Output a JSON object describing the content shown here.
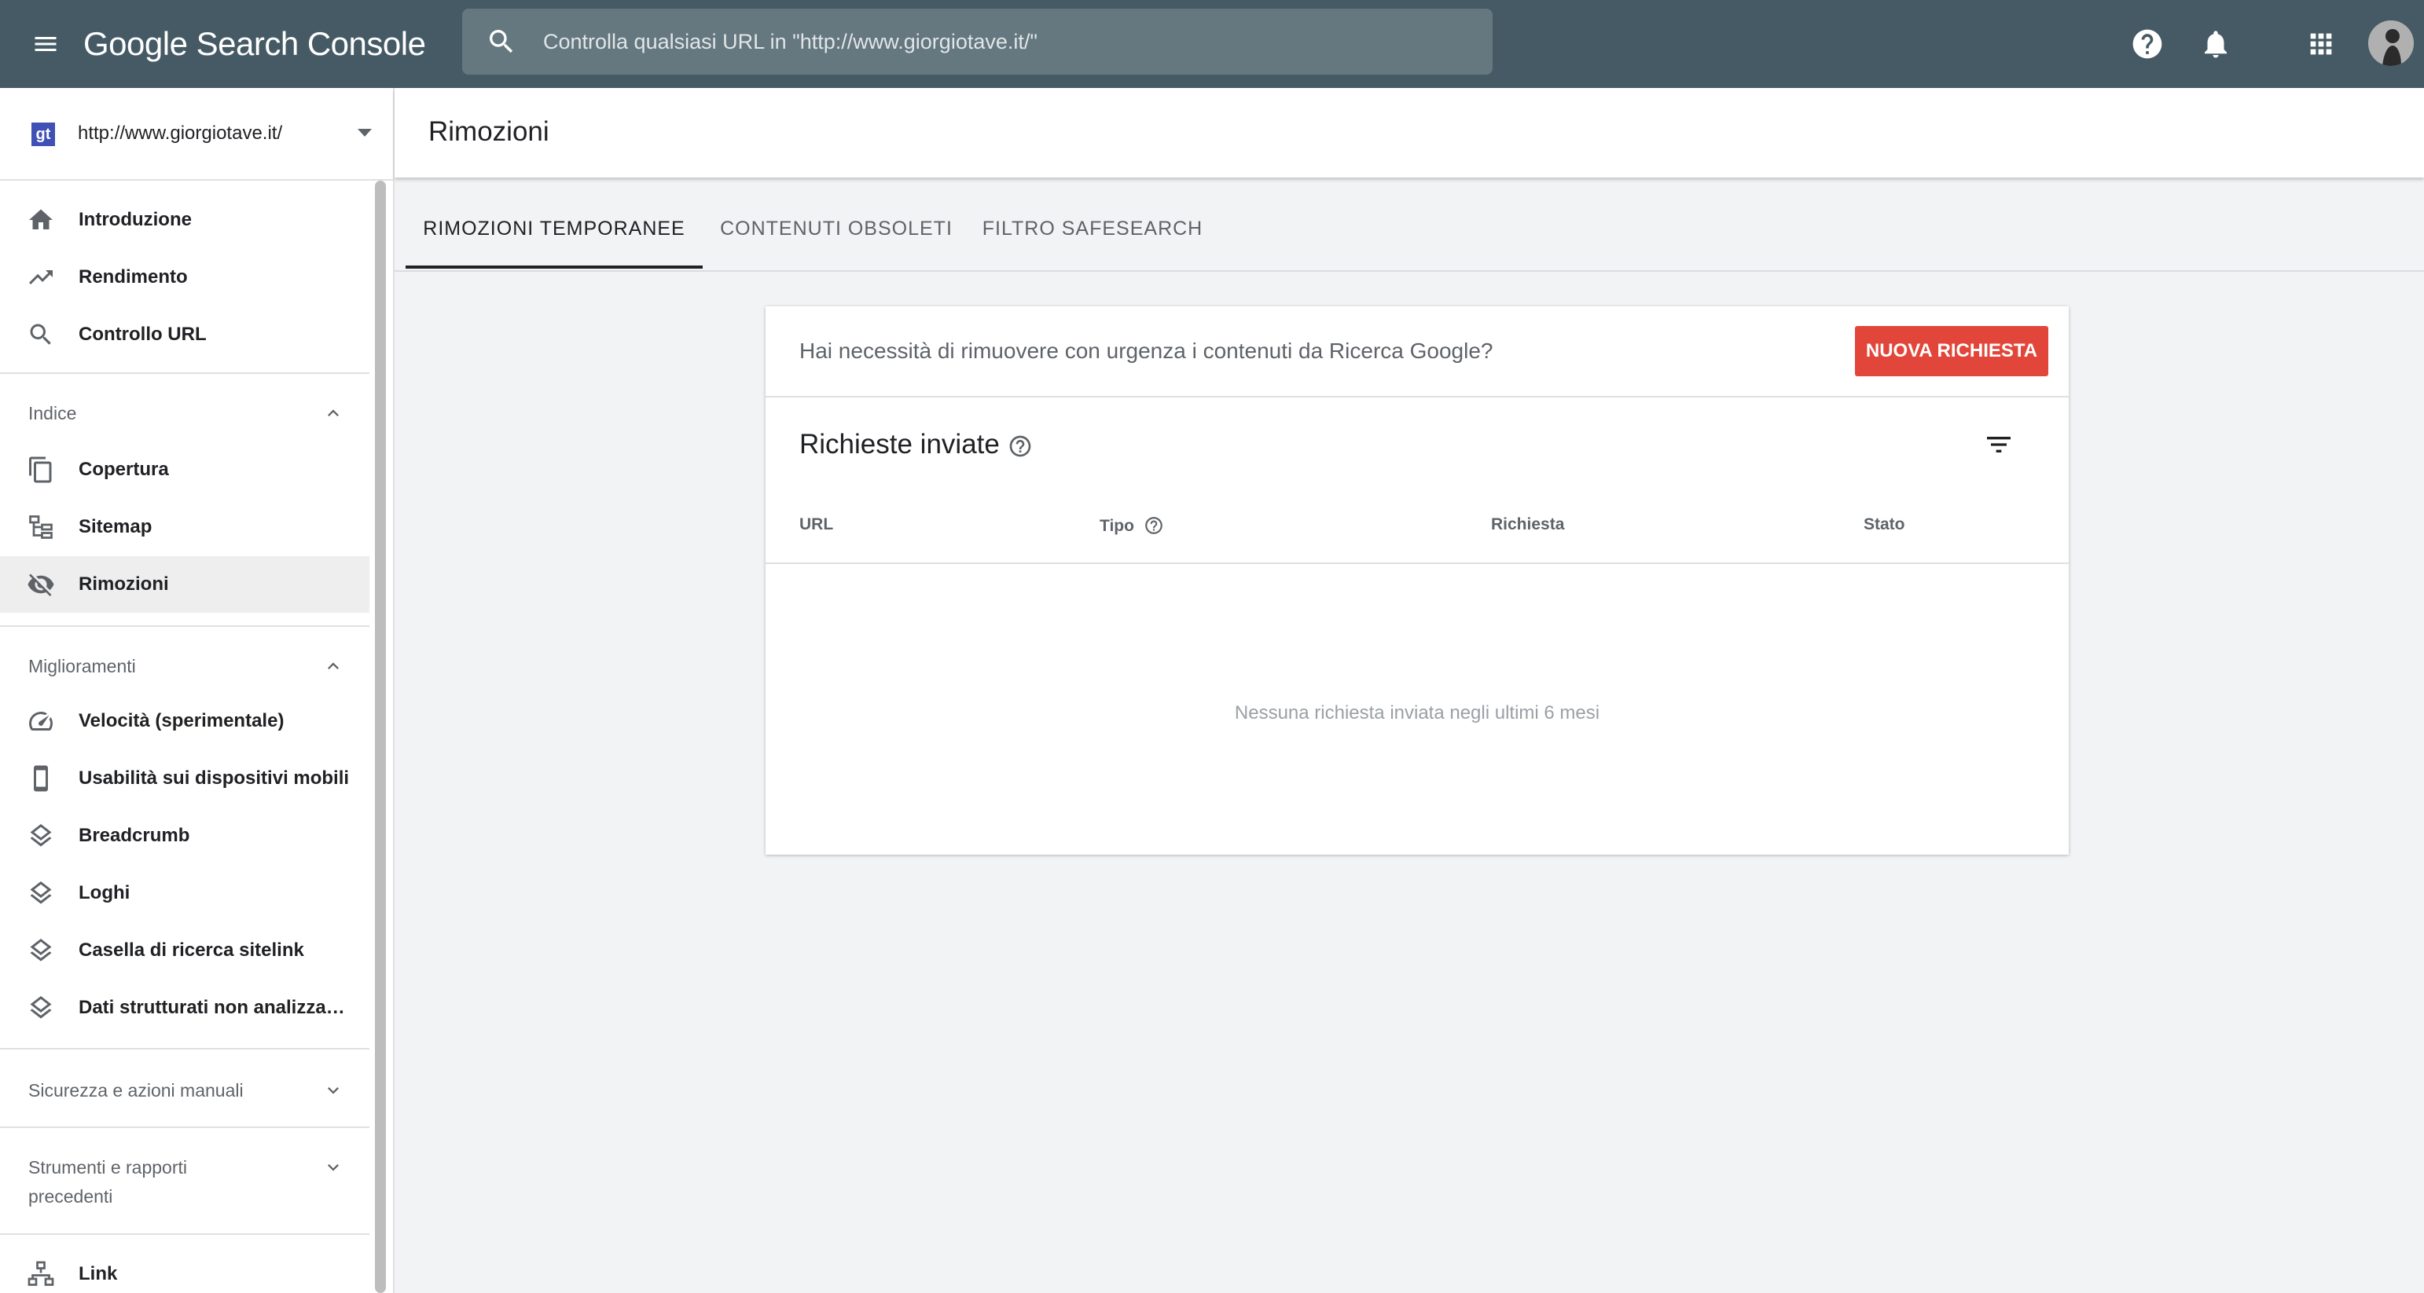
{
  "topbar": {
    "brand": "Google Search Console",
    "search_placeholder": "Controlla qualsiasi URL in \"http://www.giorgiotave.it/\""
  },
  "property": {
    "url": "http://www.giorgiotave.it/",
    "favicon_text": "gt"
  },
  "nav": {
    "top": [
      {
        "label": "Introduzione",
        "icon": "home-icon"
      },
      {
        "label": "Rendimento",
        "icon": "trending-up-icon"
      },
      {
        "label": "Controllo URL",
        "icon": "search-icon"
      }
    ],
    "indice": {
      "title": "Indice",
      "items": [
        {
          "label": "Copertura",
          "icon": "copy-icon"
        },
        {
          "label": "Sitemap",
          "icon": "sitemap-icon"
        },
        {
          "label": "Rimozioni",
          "icon": "eye-off-icon",
          "active": true
        }
      ]
    },
    "miglioramenti": {
      "title": "Miglioramenti",
      "items": [
        {
          "label": "Velocità (sperimentale)",
          "icon": "speed-icon"
        },
        {
          "label": "Usabilità sui dispositivi mobili",
          "icon": "smartphone-icon"
        },
        {
          "label": "Breadcrumb",
          "icon": "layers-icon"
        },
        {
          "label": "Loghi",
          "icon": "layers-icon"
        },
        {
          "label": "Casella di ricerca sitelink",
          "icon": "layers-icon"
        },
        {
          "label": "Dati strutturati non analizza…",
          "icon": "layers-icon"
        }
      ]
    },
    "sicurezza": {
      "title": "Sicurezza e azioni manuali"
    },
    "strumenti": {
      "title_line1": "Strumenti e rapporti",
      "title_line2": "precedenti"
    },
    "bottom": [
      {
        "label": "Link",
        "icon": "link-tree-icon"
      }
    ]
  },
  "page": {
    "title": "Rimozioni",
    "tabs": [
      "RIMOZIONI TEMPORANEE",
      "CONTENUTI OBSOLETI",
      "FILTRO SAFESEARCH"
    ],
    "active_tab": 0
  },
  "card": {
    "question": "Hai necessità di rimuovere con urgenza i contenuti da Ricerca Google?",
    "new_request_label": "NUOVA RICHIESTA",
    "title": "Richieste inviate",
    "columns": [
      "URL",
      "Tipo",
      "Richiesta",
      "Stato"
    ],
    "empty_message": "Nessuna richiesta inviata negli ultimi 6 mesi"
  },
  "colors": {
    "topbar": "#455a64",
    "search_bg": "#65777f",
    "accent_button": "#e2463a",
    "active_nav_bg": "#eeeeee"
  }
}
